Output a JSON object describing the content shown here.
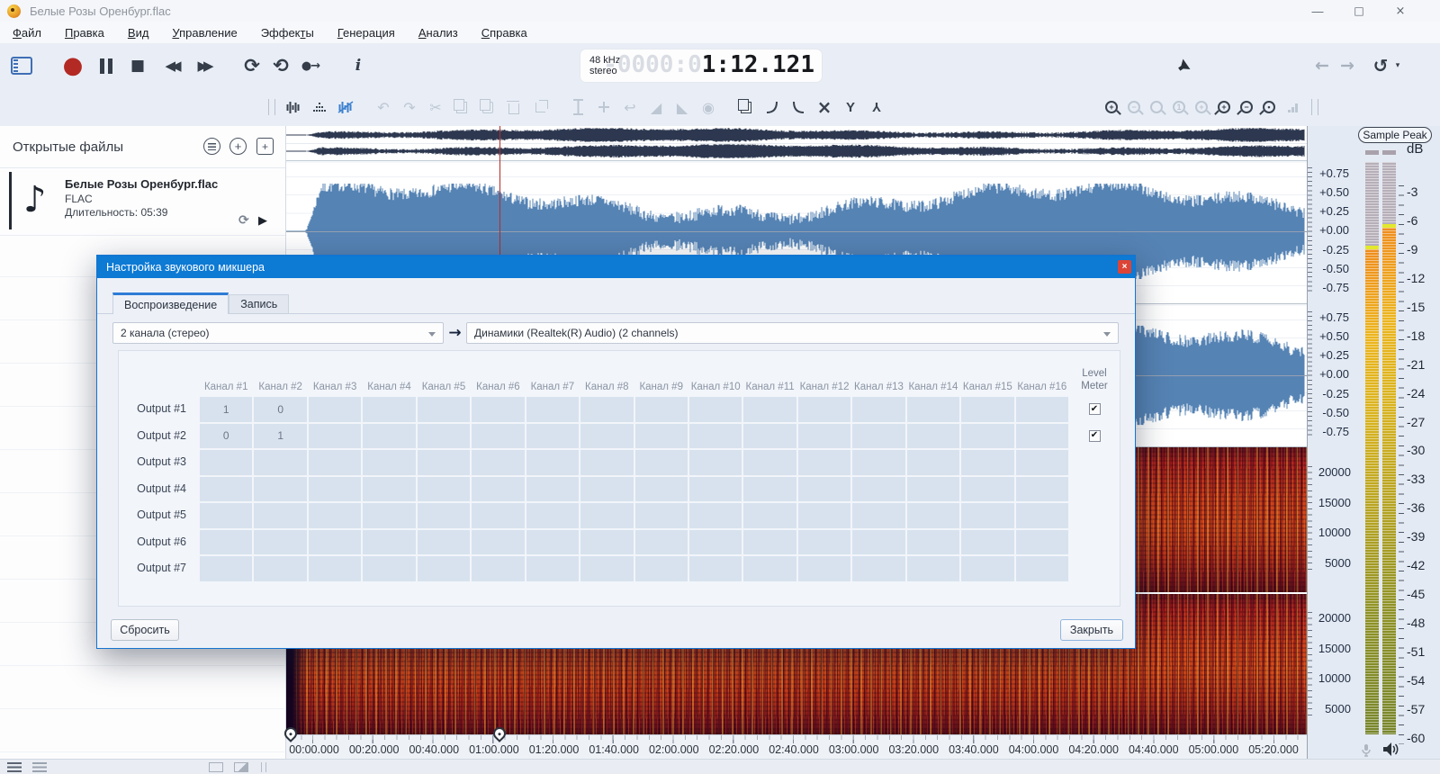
{
  "window": {
    "title": "Белые Розы Оренбург.flac",
    "controls": {
      "minimize": "—",
      "maximize": "□",
      "close": "×"
    }
  },
  "menu": [
    {
      "pre": "",
      "key": "Ф",
      "post": "айл"
    },
    {
      "pre": "",
      "key": "П",
      "post": "равка"
    },
    {
      "pre": "",
      "key": "В",
      "post": "ид"
    },
    {
      "pre": "",
      "key": "У",
      "post": "правление"
    },
    {
      "pre": "Эффек",
      "key": "т",
      "post": "ы"
    },
    {
      "pre": "",
      "key": "Г",
      "post": "енерация"
    },
    {
      "pre": "",
      "key": "А",
      "post": "нализ"
    },
    {
      "pre": "",
      "key": "С",
      "post": "правка"
    }
  ],
  "transport": {
    "sample_rate": "48 kHz",
    "channel_mode": "stereo",
    "time_dim": "-0000:0",
    "time_main": "1:12.121"
  },
  "sidebar": {
    "title": "Открытые файлы",
    "file": {
      "name": "Белые Розы Оренбург.flac",
      "format": "FLAC",
      "duration": "Длительность: 05:39"
    }
  },
  "scales": {
    "amplitude": [
      "+0.75",
      "+0.50",
      "+0.25",
      "+0.00",
      "-0.25",
      "-0.50",
      "-0.75"
    ],
    "frequency": [
      "20000",
      "15000",
      "10000",
      "5000"
    ],
    "meter_label": "Sample Peak",
    "db_unit": "dB",
    "db_ticks": [
      "-3",
      "-6",
      "-9",
      "-12",
      "-15",
      "-18",
      "-21",
      "-24",
      "-27",
      "-30",
      "-33",
      "-36",
      "-39",
      "-42",
      "-45",
      "-48",
      "-51",
      "-54",
      "-57",
      "-60"
    ]
  },
  "timeline": [
    "00:00.000",
    "00:20.000",
    "00:40.000",
    "01:00.000",
    "01:20.000",
    "01:40.000",
    "02:00.000",
    "02:20.000",
    "02:40.000",
    "03:00.000",
    "03:20.000",
    "03:40.000",
    "04:00.000",
    "04:20.000",
    "04:40.000",
    "05:00.000",
    "05:20.000"
  ],
  "dialog": {
    "title": "Настройка звукового микшера",
    "tabs": [
      "Воспроизведение",
      "Запись"
    ],
    "channel_select": "2 канала (стерео)",
    "device_select": "Динамики (Realtek(R) Audio) (2 channels)",
    "matrix": {
      "columns": [
        "Канал #1",
        "Канал #2",
        "Канал #3",
        "Канал #4",
        "Канал #5",
        "Канал #6",
        "Канал #7",
        "Канал #8",
        "Канал #9",
        "Канал #10",
        "Канал #11",
        "Канал #12",
        "Канал #13",
        "Канал #14",
        "Канал #15",
        "Канал #16"
      ],
      "level_header_1": "Level",
      "level_header_2": "Meter",
      "rows": [
        {
          "label": "Output #1",
          "level_meter": true,
          "values": [
            "1",
            "0",
            "",
            "",
            "",
            "",
            "",
            "",
            "",
            "",
            "",
            "",
            "",
            "",
            "",
            ""
          ]
        },
        {
          "label": "Output #2",
          "level_meter": true,
          "values": [
            "0",
            "1",
            "",
            "",
            "",
            "",
            "",
            "",
            "",
            "",
            "",
            "",
            "",
            "",
            "",
            ""
          ]
        },
        {
          "label": "Output #3",
          "level_meter": false,
          "values": [
            "",
            "",
            "",
            "",
            "",
            "",
            "",
            "",
            "",
            "",
            "",
            "",
            "",
            "",
            "",
            ""
          ]
        },
        {
          "label": "Output #4",
          "level_meter": false,
          "values": [
            "",
            "",
            "",
            "",
            "",
            "",
            "",
            "",
            "",
            "",
            "",
            "",
            "",
            "",
            "",
            ""
          ]
        },
        {
          "label": "Output #5",
          "level_meter": false,
          "values": [
            "",
            "",
            "",
            "",
            "",
            "",
            "",
            "",
            "",
            "",
            "",
            "",
            "",
            "",
            "",
            ""
          ]
        },
        {
          "label": "Output #6",
          "level_meter": false,
          "values": [
            "",
            "",
            "",
            "",
            "",
            "",
            "",
            "",
            "",
            "",
            "",
            "",
            "",
            "",
            "",
            ""
          ]
        },
        {
          "label": "Output #7",
          "level_meter": false,
          "values": [
            "",
            "",
            "",
            "",
            "",
            "",
            "",
            "",
            "",
            "",
            "",
            "",
            "",
            "",
            "",
            ""
          ]
        }
      ]
    },
    "buttons": {
      "reset": "Сбросить",
      "close": "Закрыть"
    }
  },
  "icons": {
    "record": "●",
    "stop": "■",
    "rewind": "◀◀",
    "forward": "▶▶",
    "loop": "⟳",
    "loop_selection": "⟲",
    "play_from_cursor": "●→",
    "info": "i",
    "back_arrow": "←",
    "forward_arrow": "→",
    "history": "↺",
    "caret": "▾",
    "undo": "↶",
    "redo": "↷",
    "cut": "✂",
    "rotate": "↩",
    "fade_in": "◢",
    "fade_out": "◣",
    "normalize": "◉",
    "cross": "×",
    "split": "Y",
    "merge": "Y",
    "note": "♪",
    "file_loop": "⟳",
    "file_play": "▶",
    "check": "✔",
    "route_arrow": "→",
    "close_x": "×",
    "plus": "+"
  }
}
